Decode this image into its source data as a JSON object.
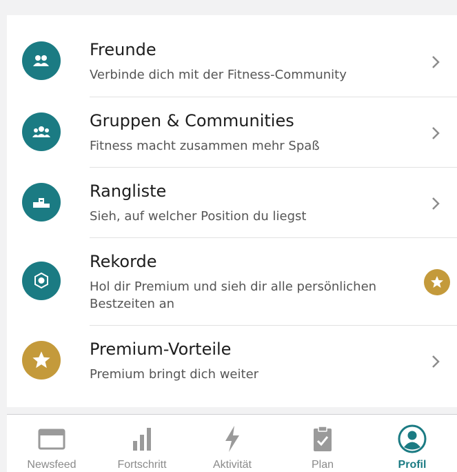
{
  "menu": {
    "items": [
      {
        "title": "Freunde",
        "subtitle": "Verbinde dich mit der Fitness-Community",
        "icon": "friends-icon",
        "icon_color": "#1b7b83",
        "trailing": "chevron-right-icon"
      },
      {
        "title": "Gruppen & Communities",
        "subtitle": "Fitness macht zusammen mehr Spaß",
        "icon": "groups-icon",
        "icon_color": "#1b7b83",
        "trailing": "chevron-right-icon"
      },
      {
        "title": "Rangliste",
        "subtitle": "Sieh, auf welcher Position du liegst",
        "icon": "podium-icon",
        "icon_color": "#1b7b83",
        "trailing": "chevron-right-icon"
      },
      {
        "title": "Rekorde",
        "subtitle_line1": "Hol dir Premium und sieh dir alle persönlichen",
        "subtitle_line2": "Bestzeiten an",
        "icon": "medal-icon",
        "icon_color": "#1b7b83",
        "trailing": "premium-star-icon"
      },
      {
        "title": "Premium-Vorteile",
        "subtitle": "Premium bringt dich weiter",
        "icon": "star-icon",
        "icon_color": "#c49a3b",
        "trailing": "chevron-right-icon"
      }
    ]
  },
  "tabbar": {
    "tabs": [
      {
        "label": "Newsfeed",
        "icon": "newsfeed-icon"
      },
      {
        "label": "Fortschritt",
        "icon": "progress-chart-icon"
      },
      {
        "label": "Aktivität",
        "icon": "lightning-icon"
      },
      {
        "label": "Plan",
        "icon": "clipboard-check-icon"
      },
      {
        "label": "Profil",
        "icon": "profile-icon",
        "active": true
      }
    ]
  },
  "colors": {
    "accent": "#1b7b83",
    "premium": "#c49a3b",
    "inactive": "#8a8a8a"
  }
}
